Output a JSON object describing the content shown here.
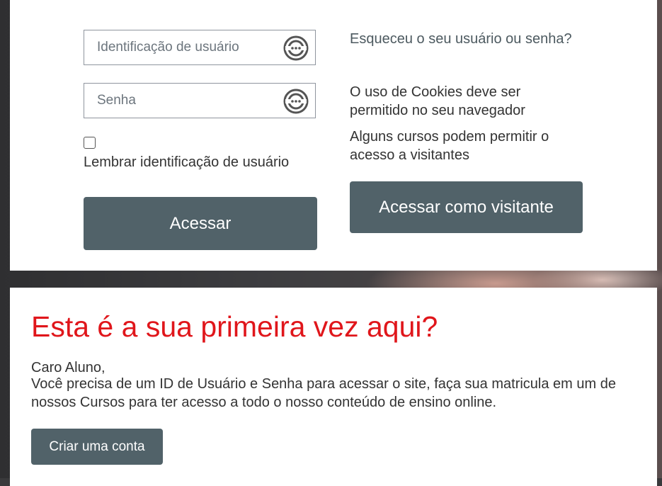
{
  "login": {
    "username_placeholder": "Identificação de usuário",
    "password_placeholder": "Senha",
    "remember_label": "Lembrar identificação de usuário",
    "remember_checked": false,
    "submit_label": "Acessar"
  },
  "info": {
    "forgot_link": "Esqueceu o seu usuário ou senha?",
    "cookies_notice": "O uso de Cookies deve ser permitido no seu navegador",
    "guest_notice": "Alguns cursos podem permitir o acesso a visitantes",
    "guest_button": "Acessar como visitante"
  },
  "signup": {
    "title": "Esta é a sua primeira vez aqui?",
    "greeting": "Caro Aluno,",
    "message": "Você precisa de um ID de Usuário e Senha para acessar o site, faça sua matricula em um de nossos Cursos para ter acesso a todo o nosso conteúdo de ensino online.",
    "create_button": "Criar uma conta"
  },
  "icons": {
    "field_icon": "password-manager-icon"
  },
  "colors": {
    "button_bg": "#516269",
    "headline": "#e0161b",
    "text": "#333333"
  }
}
